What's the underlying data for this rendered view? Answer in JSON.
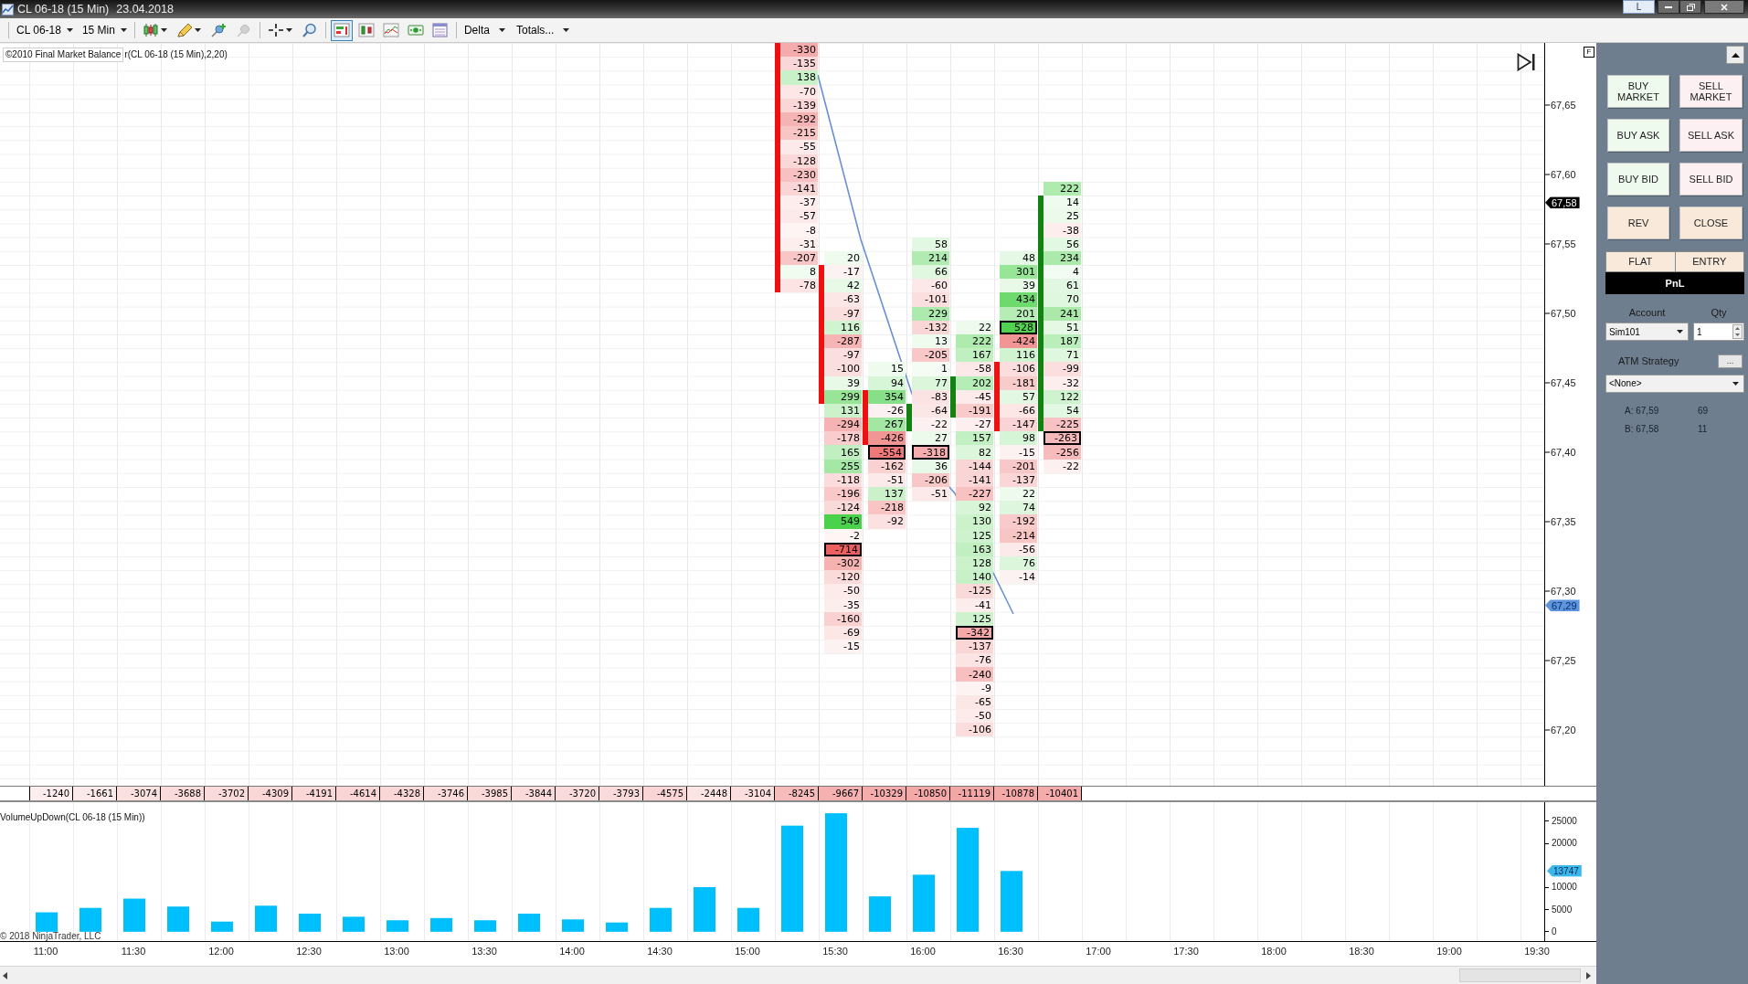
{
  "window": {
    "title": "CL 06-18 (15 Min)",
    "date": "23.04.2018",
    "link_button": "L"
  },
  "toolbar": {
    "instrument": "CL 06-18",
    "interval": "15 Min",
    "tools": [
      {
        "selected": false,
        "disabled": false
      },
      {
        "selected": false,
        "disabled": false
      },
      {
        "selected": false,
        "disabled": false
      },
      {
        "selected": false,
        "disabled": true
      },
      {
        "selected": false,
        "disabled": false
      },
      {
        "selected": false,
        "disabled": false
      },
      {
        "selected": true,
        "disabled": false
      },
      {
        "selected": false,
        "disabled": false
      },
      {
        "selected": false,
        "disabled": false
      },
      {
        "selected": false,
        "disabled": false
      },
      {
        "selected": false,
        "disabled": false
      }
    ],
    "indicator": "Delta",
    "preset": "Totals..."
  },
  "price_panel": {
    "indicator_badge": "©2010 Final Market Balance",
    "indicator_label": "r(CL 06-18 (15 Min),2,20)",
    "axis_button": "F",
    "footprint": [
      {
        "kind": "down",
        "cells": [
          {
            "value": "-330",
            "body": true,
            "boxed": false
          },
          {
            "value": "-135",
            "body": true,
            "boxed": false
          },
          {
            "value": "138",
            "body": true,
            "boxed": false
          },
          {
            "value": "-70",
            "body": true,
            "boxed": false
          },
          {
            "value": "-139",
            "body": true,
            "boxed": false
          },
          {
            "value": "-292",
            "body": true,
            "boxed": false
          },
          {
            "value": "-215",
            "body": true,
            "boxed": false
          },
          {
            "value": "-55",
            "body": true,
            "boxed": false
          },
          {
            "value": "-128",
            "body": true,
            "boxed": false
          },
          {
            "value": "-230",
            "body": true,
            "boxed": false
          },
          {
            "value": "-141",
            "body": true,
            "boxed": false
          },
          {
            "value": "-37",
            "body": true,
            "boxed": false
          },
          {
            "value": "-57",
            "body": true,
            "boxed": false
          },
          {
            "value": "-8",
            "body": true,
            "boxed": false
          },
          {
            "value": "-31",
            "body": true,
            "boxed": false
          },
          {
            "value": "-207",
            "body": true,
            "boxed": false
          },
          {
            "value": "8",
            "body": true,
            "boxed": false
          },
          {
            "value": "-78",
            "body": true,
            "boxed": false
          }
        ]
      },
      {
        "kind": "down",
        "cells": [
          null,
          null,
          null,
          null,
          null,
          null,
          null,
          null,
          null,
          null,
          null,
          null,
          null,
          null,
          null,
          {
            "value": "20",
            "body": false,
            "boxed": false
          },
          {
            "value": "-17",
            "body": true,
            "boxed": false
          },
          {
            "value": "42",
            "body": true,
            "boxed": false
          },
          {
            "value": "-63",
            "body": true,
            "boxed": false
          },
          {
            "value": "-97",
            "body": true,
            "boxed": false
          },
          {
            "value": "116",
            "body": true,
            "boxed": false
          },
          {
            "value": "-287",
            "body": true,
            "boxed": false
          },
          {
            "value": "-97",
            "body": true,
            "boxed": false
          },
          {
            "value": "-100",
            "body": true,
            "boxed": false
          },
          {
            "value": "39",
            "body": true,
            "boxed": false
          },
          {
            "value": "299",
            "body": true,
            "boxed": false
          },
          {
            "value": "131",
            "body": false,
            "boxed": false
          },
          {
            "value": "-294",
            "body": false,
            "boxed": false
          },
          {
            "value": "-178",
            "body": false,
            "boxed": false
          },
          {
            "value": "165",
            "body": false,
            "boxed": false
          },
          {
            "value": "255",
            "body": false,
            "boxed": false
          },
          {
            "value": "-118",
            "body": false,
            "boxed": false
          },
          {
            "value": "-196",
            "body": false,
            "boxed": false
          },
          {
            "value": "-124",
            "body": false,
            "boxed": false
          },
          {
            "value": "549",
            "body": false,
            "boxed": false
          },
          {
            "value": "-2",
            "body": false,
            "boxed": false
          },
          {
            "value": "-714",
            "body": false,
            "boxed": true
          },
          {
            "value": "-302",
            "body": false,
            "boxed": false
          },
          {
            "value": "-120",
            "body": false,
            "boxed": false
          },
          {
            "value": "-50",
            "body": false,
            "boxed": false
          },
          {
            "value": "-35",
            "body": false,
            "boxed": false
          },
          {
            "value": "-160",
            "body": false,
            "boxed": false
          },
          {
            "value": "-69",
            "body": false,
            "boxed": false
          },
          {
            "value": "-15",
            "body": false,
            "boxed": false
          }
        ]
      },
      {
        "kind": "down",
        "cells": [
          null,
          null,
          null,
          null,
          null,
          null,
          null,
          null,
          null,
          null,
          null,
          null,
          null,
          null,
          null,
          null,
          null,
          null,
          null,
          null,
          null,
          null,
          null,
          {
            "value": "15",
            "body": false,
            "boxed": false
          },
          {
            "value": "94",
            "body": false,
            "boxed": false
          },
          {
            "value": "354",
            "body": true,
            "boxed": false
          },
          {
            "value": "-26",
            "body": true,
            "boxed": false
          },
          {
            "value": "267",
            "body": true,
            "boxed": false
          },
          {
            "value": "-426",
            "body": true,
            "boxed": false
          },
          {
            "value": "-554",
            "body": false,
            "boxed": true
          },
          {
            "value": "-162",
            "body": false,
            "boxed": false
          },
          {
            "value": "-51",
            "body": false,
            "boxed": false
          },
          {
            "value": "137",
            "body": false,
            "boxed": false
          },
          {
            "value": "-218",
            "body": false,
            "boxed": false
          },
          {
            "value": "-92",
            "body": false,
            "boxed": false
          }
        ]
      },
      {
        "kind": "up",
        "cells": [
          null,
          null,
          null,
          null,
          null,
          null,
          null,
          null,
          null,
          null,
          null,
          null,
          null,
          null,
          {
            "value": "58",
            "body": false,
            "boxed": false
          },
          {
            "value": "214",
            "body": false,
            "boxed": false
          },
          {
            "value": "66",
            "body": false,
            "boxed": false
          },
          {
            "value": "-60",
            "body": false,
            "boxed": false
          },
          {
            "value": "-101",
            "body": false,
            "boxed": false
          },
          {
            "value": "229",
            "body": false,
            "boxed": false
          },
          {
            "value": "-132",
            "body": false,
            "boxed": false
          },
          {
            "value": "13",
            "body": false,
            "boxed": false
          },
          {
            "value": "-205",
            "body": false,
            "boxed": false
          },
          {
            "value": "1",
            "body": false,
            "boxed": false
          },
          {
            "value": "77",
            "body": false,
            "boxed": false
          },
          {
            "value": "-83",
            "body": false,
            "boxed": false
          },
          {
            "value": "-64",
            "body": true,
            "boxed": false
          },
          {
            "value": "-22",
            "body": true,
            "boxed": false
          },
          {
            "value": "27",
            "body": false,
            "boxed": false
          },
          {
            "value": "-318",
            "body": false,
            "boxed": true
          },
          {
            "value": "36",
            "body": false,
            "boxed": false
          },
          {
            "value": "-206",
            "body": false,
            "boxed": false
          },
          {
            "value": "-51",
            "body": false,
            "boxed": false
          }
        ]
      },
      {
        "kind": "up",
        "cells": [
          null,
          null,
          null,
          null,
          null,
          null,
          null,
          null,
          null,
          null,
          null,
          null,
          null,
          null,
          null,
          null,
          null,
          null,
          null,
          null,
          {
            "value": "22",
            "body": false,
            "boxed": false
          },
          {
            "value": "222",
            "body": false,
            "boxed": false
          },
          {
            "value": "167",
            "body": false,
            "boxed": false
          },
          {
            "value": "-58",
            "body": false,
            "boxed": false
          },
          {
            "value": "202",
            "body": true,
            "boxed": false
          },
          {
            "value": "-45",
            "body": true,
            "boxed": false
          },
          {
            "value": "-191",
            "body": true,
            "boxed": false
          },
          {
            "value": "-27",
            "body": false,
            "boxed": false
          },
          {
            "value": "157",
            "body": false,
            "boxed": false
          },
          {
            "value": "82",
            "body": false,
            "boxed": false
          },
          {
            "value": "-144",
            "body": false,
            "boxed": false
          },
          {
            "value": "-141",
            "body": false,
            "boxed": false
          },
          {
            "value": "-227",
            "body": false,
            "boxed": false
          },
          {
            "value": "92",
            "body": false,
            "boxed": false
          },
          {
            "value": "130",
            "body": false,
            "boxed": false
          },
          {
            "value": "125",
            "body": false,
            "boxed": false
          },
          {
            "value": "163",
            "body": false,
            "boxed": false
          },
          {
            "value": "128",
            "body": false,
            "boxed": false
          },
          {
            "value": "140",
            "body": false,
            "boxed": false
          },
          {
            "value": "-125",
            "body": false,
            "boxed": false
          },
          {
            "value": "-41",
            "body": false,
            "boxed": false
          },
          {
            "value": "125",
            "body": false,
            "boxed": false
          },
          {
            "value": "-342",
            "body": false,
            "boxed": true
          },
          {
            "value": "-137",
            "body": false,
            "boxed": false
          },
          {
            "value": "-76",
            "body": false,
            "boxed": false
          },
          {
            "value": "-240",
            "body": false,
            "boxed": false
          },
          {
            "value": "-9",
            "body": false,
            "boxed": false
          },
          {
            "value": "-65",
            "body": false,
            "boxed": false
          },
          {
            "value": "-50",
            "body": false,
            "boxed": false
          },
          {
            "value": "-106",
            "body": false,
            "boxed": false
          }
        ]
      },
      {
        "kind": "down",
        "cells": [
          null,
          null,
          null,
          null,
          null,
          null,
          null,
          null,
          null,
          null,
          null,
          null,
          null,
          null,
          null,
          {
            "value": "48",
            "body": false,
            "boxed": false
          },
          {
            "value": "301",
            "body": false,
            "boxed": false
          },
          {
            "value": "39",
            "body": false,
            "boxed": false
          },
          {
            "value": "434",
            "body": false,
            "boxed": false
          },
          {
            "value": "201",
            "body": false,
            "boxed": false
          },
          {
            "value": "528",
            "body": false,
            "boxed": true
          },
          {
            "value": "-424",
            "body": false,
            "boxed": false
          },
          {
            "value": "116",
            "body": false,
            "boxed": false
          },
          {
            "value": "-106",
            "body": true,
            "boxed": false
          },
          {
            "value": "-181",
            "body": true,
            "boxed": false
          },
          {
            "value": "57",
            "body": true,
            "boxed": false
          },
          {
            "value": "-66",
            "body": true,
            "boxed": false
          },
          {
            "value": "-147",
            "body": true,
            "boxed": false
          },
          {
            "value": "98",
            "body": false,
            "boxed": false
          },
          {
            "value": "-15",
            "body": false,
            "boxed": false
          },
          {
            "value": "-201",
            "body": false,
            "boxed": false
          },
          {
            "value": "-137",
            "body": false,
            "boxed": false
          },
          {
            "value": "22",
            "body": false,
            "boxed": false
          },
          {
            "value": "74",
            "body": false,
            "boxed": false
          },
          {
            "value": "-192",
            "body": false,
            "boxed": false
          },
          {
            "value": "-214",
            "body": false,
            "boxed": false
          },
          {
            "value": "-56",
            "body": false,
            "boxed": false
          },
          {
            "value": "76",
            "body": false,
            "boxed": false
          },
          {
            "value": "-14",
            "body": false,
            "boxed": false
          }
        ]
      },
      {
        "kind": "up",
        "cells": [
          null,
          null,
          null,
          null,
          null,
          null,
          null,
          null,
          null,
          null,
          {
            "value": "222",
            "body": false,
            "boxed": false
          },
          {
            "value": "14",
            "body": true,
            "boxed": false
          },
          {
            "value": "25",
            "body": true,
            "boxed": false
          },
          {
            "value": "-38",
            "body": true,
            "boxed": false
          },
          {
            "value": "56",
            "body": true,
            "boxed": false
          },
          {
            "value": "234",
            "body": true,
            "boxed": false
          },
          {
            "value": "4",
            "body": true,
            "boxed": false
          },
          {
            "value": "61",
            "body": true,
            "boxed": false
          },
          {
            "value": "70",
            "body": true,
            "boxed": false
          },
          {
            "value": "241",
            "body": true,
            "boxed": false
          },
          {
            "value": "51",
            "body": true,
            "boxed": false
          },
          {
            "value": "187",
            "body": true,
            "boxed": false
          },
          {
            "value": "71",
            "body": true,
            "boxed": false
          },
          {
            "value": "-99",
            "body": true,
            "boxed": false
          },
          {
            "value": "-32",
            "body": true,
            "boxed": false
          },
          {
            "value": "122",
            "body": true,
            "boxed": false
          },
          {
            "value": "54",
            "body": true,
            "boxed": false
          },
          {
            "value": "-225",
            "body": true,
            "boxed": false
          },
          {
            "value": "-263",
            "body": false,
            "boxed": true
          },
          {
            "value": "-256",
            "body": false,
            "boxed": false
          },
          {
            "value": "-22",
            "body": false,
            "boxed": false
          }
        ]
      }
    ],
    "price_axis": {
      "labels": [
        "67,65",
        "67,60",
        "67,55",
        "67,50",
        "67,45",
        "67,40",
        "67,35",
        "67,30",
        "67,25",
        "67,20"
      ],
      "markers": [
        {
          "label": "67,58",
          "kind": "last"
        },
        {
          "label": "67,29",
          "kind": "line"
        }
      ]
    }
  },
  "totals": [
    "-1240",
    "-1661",
    "-3074",
    "-3688",
    "-3702",
    "-4309",
    "-4191",
    "-4614",
    "-4328",
    "-3746",
    "-3985",
    "-3844",
    "-3720",
    "-3793",
    "-4575",
    "-2448",
    "-3104",
    "-8245",
    "-9667",
    "-10329",
    "-10850",
    "-11119",
    "-10878",
    "-10401"
  ],
  "volume_panel": {
    "title": "VolumeUpDown(CL 06-18 (15 Min))",
    "copyright": "© 2018 NinjaTrader, LLC",
    "last_value": "13747",
    "chart_data": {
      "type": "bar",
      "categories": [
        "11:00",
        null,
        "11:30",
        null,
        "12:00",
        null,
        "12:30",
        null,
        "13:00",
        null,
        "13:30",
        null,
        "14:00",
        null,
        "14:30",
        null,
        "15:00",
        null,
        "15:30",
        null,
        "16:00",
        null,
        "16:30",
        null,
        "17:00",
        null,
        "17:30",
        null,
        "18:00",
        null,
        "18:30",
        null,
        "19:00",
        null,
        "19:30"
      ],
      "values": [
        4400,
        5400,
        7500,
        5700,
        2300,
        5900,
        4100,
        3400,
        2600,
        3100,
        2600,
        4100,
        2800,
        2100,
        5400,
        10100,
        5400,
        24000,
        26800,
        8000,
        12900,
        23500,
        13747,
        null,
        null,
        null,
        null,
        null,
        null,
        null,
        null,
        null,
        null,
        null,
        null
      ],
      "ylim": [
        -2100,
        29300
      ],
      "yticks": [
        0,
        5000,
        10000,
        20000,
        25000
      ]
    }
  },
  "trade_panel": {
    "buttons": [
      {
        "label": "BUY MARKET",
        "kind": "buy"
      },
      {
        "label": "SELL MARKET",
        "kind": "sell"
      },
      {
        "label": "BUY ASK",
        "kind": "buy"
      },
      {
        "label": "SELL ASK",
        "kind": "sell"
      },
      {
        "label": "BUY BID",
        "kind": "buy"
      },
      {
        "label": "SELL BID",
        "kind": "sell"
      },
      {
        "label": "REV",
        "kind": "exit"
      },
      {
        "label": "CLOSE",
        "kind": "exit"
      }
    ],
    "position": {
      "status": "FLAT",
      "entry": "ENTRY",
      "pnl": "PnL"
    },
    "account": {
      "label": "Account",
      "value": "Sim101"
    },
    "qty": {
      "label": "Qty",
      "value": "1"
    },
    "atm_strategy": {
      "label": "ATM Strategy",
      "button": "...",
      "value": "<None>"
    },
    "quotes": [
      {
        "label": "A: 67,59",
        "size": "69"
      },
      {
        "label": "B: 67,58",
        "size": "11"
      }
    ]
  }
}
